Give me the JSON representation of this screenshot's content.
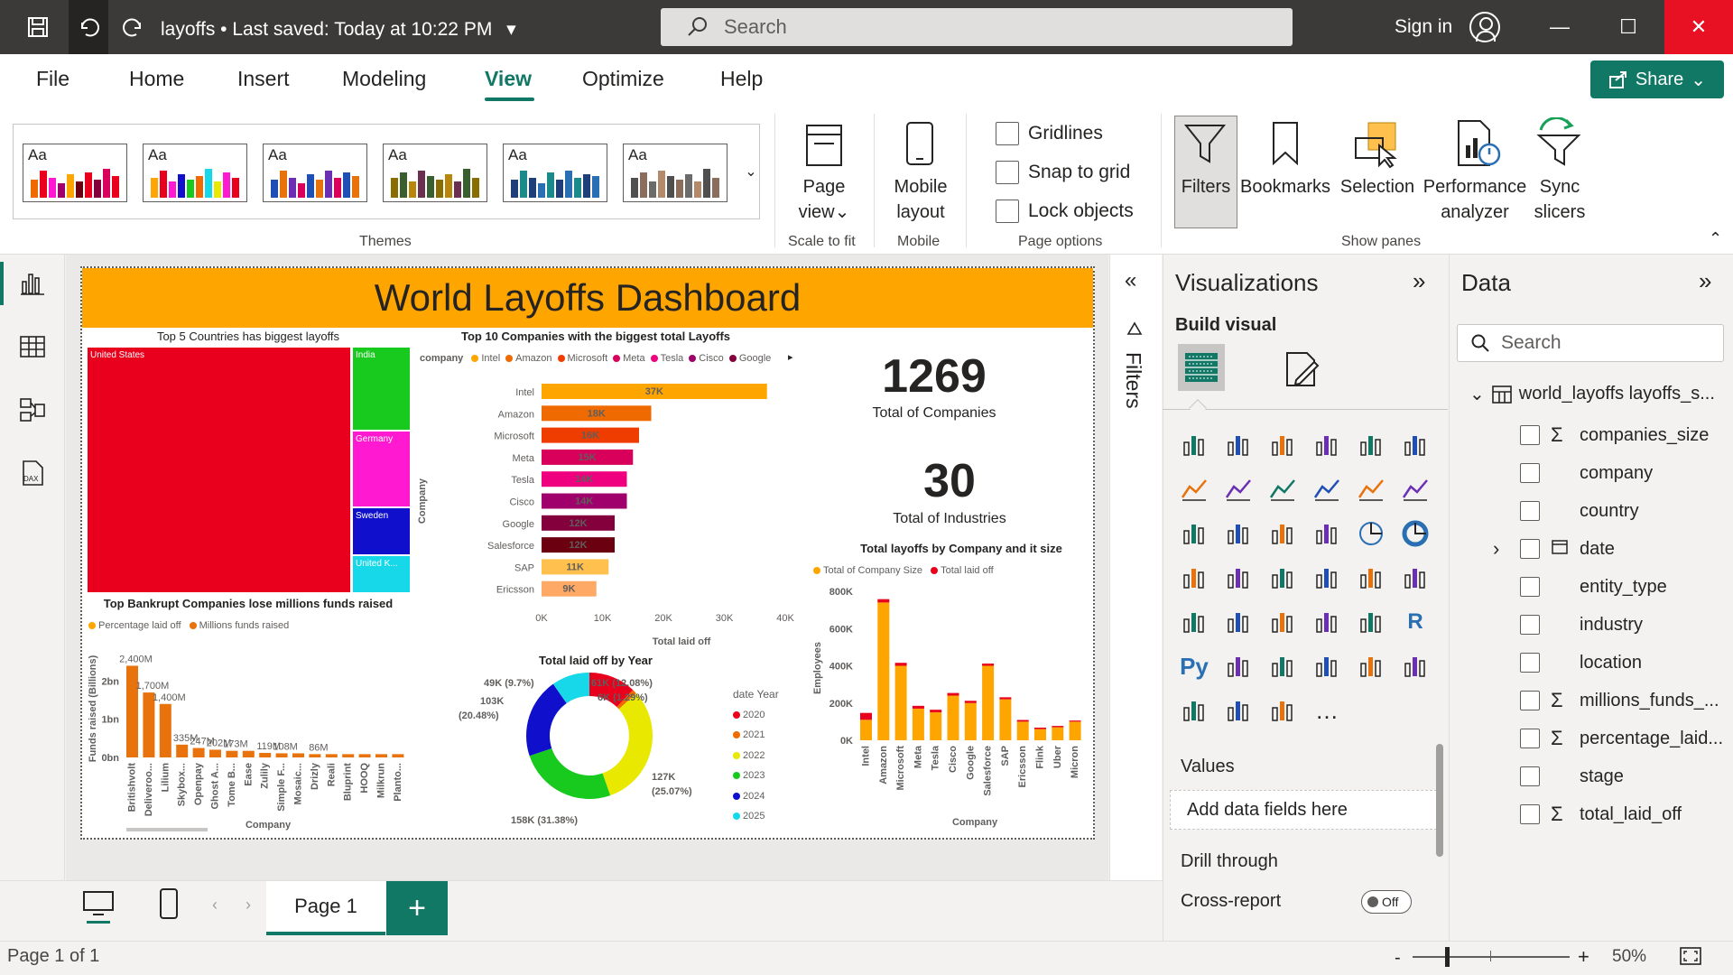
{
  "titlebar": {
    "doc_title": "layoffs",
    "saved": "Last saved: Today at 10:22 PM",
    "search_placeholder": "Search",
    "sign_in": "Sign in"
  },
  "menu": {
    "items": [
      "File",
      "Home",
      "Insert",
      "Modeling",
      "View",
      "Optimize",
      "Help"
    ],
    "active": "View",
    "share": "Share"
  },
  "ribbon": {
    "themes_label": "Themes",
    "theme_swatch_text": "Aa",
    "page_view": [
      "Page",
      "view"
    ],
    "scale_to_fit": "Scale to fit",
    "mobile_layout": [
      "Mobile",
      "layout"
    ],
    "mobile_group": "Mobile",
    "checkbox_gridlines": "Gridlines",
    "checkbox_snap": "Snap to grid",
    "checkbox_lock": "Lock objects",
    "page_options": "Page options",
    "panes": {
      "filters": "Filters",
      "bookmarks": "Bookmarks",
      "selection": "Selection",
      "performance": [
        "Performance",
        "analyzer"
      ],
      "sync": [
        "Sync",
        "slicers"
      ]
    },
    "show_panes": "Show panes"
  },
  "report": {
    "header": "World Layoffs Dashboard",
    "treemap": {
      "title": "Top 5 Countries has biggest layoffs",
      "cells": [
        "United States",
        "India",
        "Germany",
        "Sweden",
        "United K..."
      ]
    },
    "kpi1": {
      "value": "1269",
      "label": "Total of Companies"
    },
    "kpi2": {
      "value": "30",
      "label": "Total of Industries"
    },
    "bar_title": "Top 10 Companies with the biggest total Layoffs",
    "bar_legend_title": "company",
    "bar_xlabel": "Total laid off",
    "bar_ylabel": "Company",
    "bankrupt_title": "Top Bankrupt Companies lose millions funds raised",
    "bankrupt_legend": [
      "Percentage laid off",
      "Millions funds raised"
    ],
    "bankrupt_ylabel": "Funds raised (Billions)",
    "bankrupt_xlabel": "Company",
    "donut_title": "Total laid off by Year",
    "donut_legend_title": "date Year",
    "size_title": "Total layoffs by Company and it size",
    "size_legend": [
      "Total of Company Size",
      "Total laid off"
    ],
    "size_ylabel": "Employees",
    "size_xlabel": "Company"
  },
  "chart_data": [
    {
      "type": "treemap",
      "title": "Top 5 Countries has biggest layoffs",
      "categories": [
        "United States",
        "India",
        "Germany",
        "Sweden",
        "United K..."
      ],
      "colors": [
        "#e8001c",
        "#18c91e",
        "#ff1ad1",
        "#1010cc",
        "#17d8e8"
      ]
    },
    {
      "type": "bar",
      "orientation": "horizontal",
      "title": "Top 10 Companies with the biggest total Layoffs",
      "categories": [
        "Intel",
        "Amazon",
        "Microsoft",
        "Meta",
        "Tesla",
        "Cisco",
        "Google",
        "Salesforce",
        "SAP",
        "Ericsson"
      ],
      "values": [
        37000,
        18000,
        16000,
        15000,
        14000,
        14000,
        12000,
        12000,
        11000,
        9000
      ],
      "data_labels": [
        "37K",
        "18K",
        "16K",
        "15K",
        "14K",
        "14K",
        "12K",
        "12K",
        "11K",
        "9K"
      ],
      "colors": [
        "#ffa500",
        "#ef6a00",
        "#ef3d00",
        "#d8005a",
        "#ef007f",
        "#a0006b",
        "#84003c",
        "#6b0010",
        "#ffc04d",
        "#ffa966"
      ],
      "legend": [
        "Intel",
        "Amazon",
        "Microsoft",
        "Meta",
        "Tesla",
        "Cisco",
        "Google"
      ],
      "xticks": [
        "0K",
        "10K",
        "20K",
        "30K",
        "40K"
      ],
      "xlim": [
        0,
        40000
      ],
      "xlabel": "Total laid off",
      "ylabel": "Company"
    },
    {
      "type": "bar",
      "title": "Top Bankrupt Companies lose millions funds raised",
      "categories": [
        "Britishvolt",
        "Deliveroo...",
        "Lilium",
        "Skybox...",
        "Openpay",
        "Ghost A...",
        "Tome B...",
        "Ease",
        "Zulily",
        "Simple F...",
        "Mosaic...",
        "Drizly",
        "Reali",
        "Bluprint",
        "HOOQ",
        "Milkrun",
        "Planto..."
      ],
      "values": [
        2400,
        1700,
        1400,
        335,
        247,
        202,
        173,
        173,
        119,
        108,
        108,
        86,
        86,
        86,
        86,
        86,
        86
      ],
      "data_labels": [
        "2,400M",
        "1,700M",
        "1,400M",
        "335M",
        "247M",
        "202M",
        "173M",
        "",
        "119M",
        "108M",
        "",
        "86M",
        "",
        "",
        "",
        "",
        ""
      ],
      "yticks": [
        "0bn",
        "1bn",
        "2bn"
      ],
      "ylim": [
        0,
        2600
      ],
      "ylabel": "Funds raised (Billions)",
      "xlabel": "Company",
      "color": "#e8730c"
    },
    {
      "type": "pie",
      "donut": true,
      "title": "Total laid off by Year",
      "categories": [
        "2020",
        "2021",
        "2022",
        "2023",
        "2024",
        "2025"
      ],
      "values": [
        61000,
        6000,
        158000,
        127000,
        103000,
        49000
      ],
      "data_labels": [
        "61K (12.08%)",
        "6K (1.29%)",
        "158K (31.38%)",
        "127K (25.07%)",
        "103K (20.48%)",
        "49K (9.7%)"
      ],
      "colors": [
        "#e8001c",
        "#ef6a00",
        "#e8e800",
        "#18c91e",
        "#1010cc",
        "#17d8e8"
      ]
    },
    {
      "type": "bar",
      "stacked": true,
      "title": "Total layoffs by Company and it size",
      "categories": [
        "Intel",
        "Amazon",
        "Microsoft",
        "Meta",
        "Tesla",
        "Cisco",
        "Google",
        "Salesforce",
        "SAP",
        "Ericsson",
        "Flink",
        "Uber",
        "Micron"
      ],
      "series": [
        {
          "name": "Total of Company Size",
          "values": [
            110000,
            740000,
            400000,
            170000,
            150000,
            240000,
            200000,
            400000,
            220000,
            100000,
            60000,
            70000,
            100000
          ]
        },
        {
          "name": "Total laid off",
          "values": [
            37000,
            18000,
            16000,
            15000,
            14000,
            14000,
            12000,
            12000,
            11000,
            9000,
            8000,
            7000,
            6000
          ]
        }
      ],
      "colors": [
        "#ffa500",
        "#e8001c"
      ],
      "yticks": [
        "0K",
        "200K",
        "400K",
        "600K",
        "800K"
      ],
      "ylim": [
        0,
        800000
      ],
      "ylabel": "Employees",
      "xlabel": "Company"
    }
  ],
  "filters": {
    "label": "Filters"
  },
  "visualizations": {
    "title": "Visualizations",
    "build_visual": "Build visual",
    "values": "Values",
    "add_fields": "Add data fields here",
    "drill_through": "Drill through",
    "cross_report": "Cross-report",
    "toggle_off": "Off"
  },
  "data_pane": {
    "title": "Data",
    "search_placeholder": "Search",
    "table_name": "world_layoffs layoffs_s...",
    "fields": [
      {
        "name": "companies_size",
        "sigma": true
      },
      {
        "name": "company",
        "sigma": false
      },
      {
        "name": "country",
        "sigma": false
      },
      {
        "name": "date",
        "sigma": false,
        "date": true
      },
      {
        "name": "entity_type",
        "sigma": false
      },
      {
        "name": "industry",
        "sigma": false
      },
      {
        "name": "location",
        "sigma": false
      },
      {
        "name": "millions_funds_...",
        "sigma": true
      },
      {
        "name": "percentage_laid...",
        "sigma": true
      },
      {
        "name": "stage",
        "sigma": false
      },
      {
        "name": "total_laid_off",
        "sigma": true
      }
    ]
  },
  "pages": {
    "tab": "Page 1",
    "status": "Page 1 of 1",
    "zoom": "50%"
  }
}
